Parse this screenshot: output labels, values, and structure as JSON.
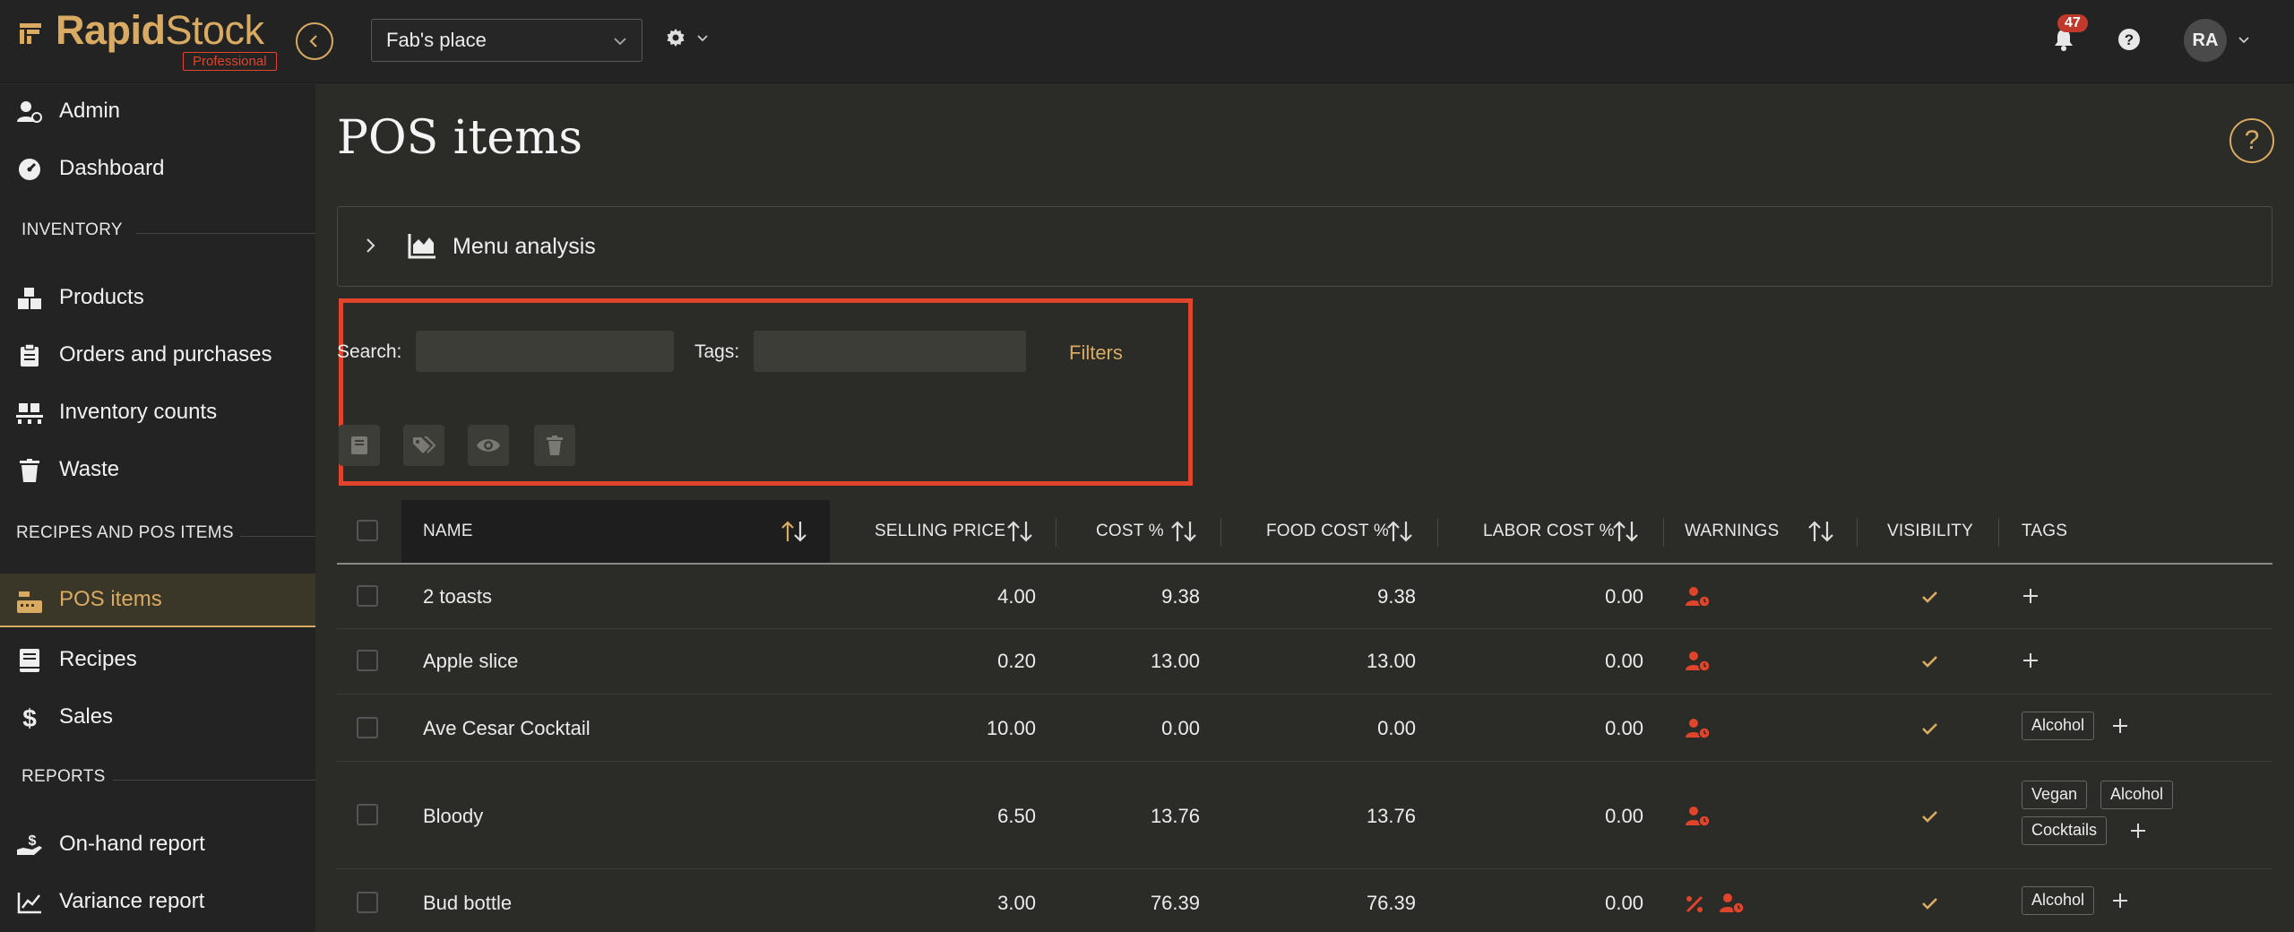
{
  "brand": {
    "name_bold": "Rapid",
    "name_light": "Stock",
    "plan_badge": "Professional"
  },
  "topbar": {
    "store_name": "Fab's place",
    "notification_count": "47",
    "avatar_initials": "RA"
  },
  "sidebar": {
    "items_top": [
      {
        "label": "Admin"
      },
      {
        "label": "Dashboard"
      }
    ],
    "section_inventory": "INVENTORY",
    "items_inventory": [
      {
        "label": "Products"
      },
      {
        "label": "Orders and purchases"
      },
      {
        "label": "Inventory counts"
      },
      {
        "label": "Waste"
      }
    ],
    "section_recipes": "RECIPES AND POS ITEMS",
    "items_recipes": [
      {
        "label": "POS items"
      },
      {
        "label": "Recipes"
      },
      {
        "label": "Sales"
      }
    ],
    "section_reports": "REPORTS",
    "items_reports": [
      {
        "label": "On-hand report"
      },
      {
        "label": "Variance report"
      }
    ]
  },
  "main": {
    "title": "POS items",
    "help_glyph": "?",
    "menu_analysis_label": "Menu analysis",
    "filters": {
      "search_label": "Search:",
      "search_value": "",
      "tags_label": "Tags:",
      "tags_value": "",
      "filters_link": "Filters"
    }
  },
  "table": {
    "headers": {
      "name": "NAME",
      "selling_price": "SELLING PRICE",
      "cost_pct": "COST %",
      "food_cost_pct": "FOOD COST %",
      "labor_cost_pct": "LABOR COST %",
      "warnings": "WARNINGS",
      "visibility": "VISIBILITY",
      "tags": "TAGS"
    },
    "rows": [
      {
        "name": "2 toasts",
        "selling_price": "4.00",
        "cost_pct": "9.38",
        "food_cost_pct": "9.38",
        "labor_cost_pct": "0.00",
        "tags": []
      },
      {
        "name": "Apple slice",
        "selling_price": "0.20",
        "cost_pct": "13.00",
        "food_cost_pct": "13.00",
        "labor_cost_pct": "0.00",
        "tags": []
      },
      {
        "name": "Ave Cesar Cocktail",
        "selling_price": "10.00",
        "cost_pct": "0.00",
        "food_cost_pct": "0.00",
        "labor_cost_pct": "0.00",
        "tags": [
          "Alcohol"
        ]
      },
      {
        "name": "Bloody",
        "selling_price": "6.50",
        "cost_pct": "13.76",
        "food_cost_pct": "13.76",
        "labor_cost_pct": "0.00",
        "tags": [
          "Vegan",
          "Alcohol",
          "Cocktails"
        ]
      },
      {
        "name": "Bud bottle",
        "selling_price": "3.00",
        "cost_pct": "76.39",
        "food_cost_pct": "76.39",
        "labor_cost_pct": "0.00",
        "tags": [
          "Alcohol"
        ]
      }
    ]
  },
  "colors": {
    "accent": "#d9aa62",
    "warning": "#e0452b",
    "highlight_box": "#e0452b"
  }
}
